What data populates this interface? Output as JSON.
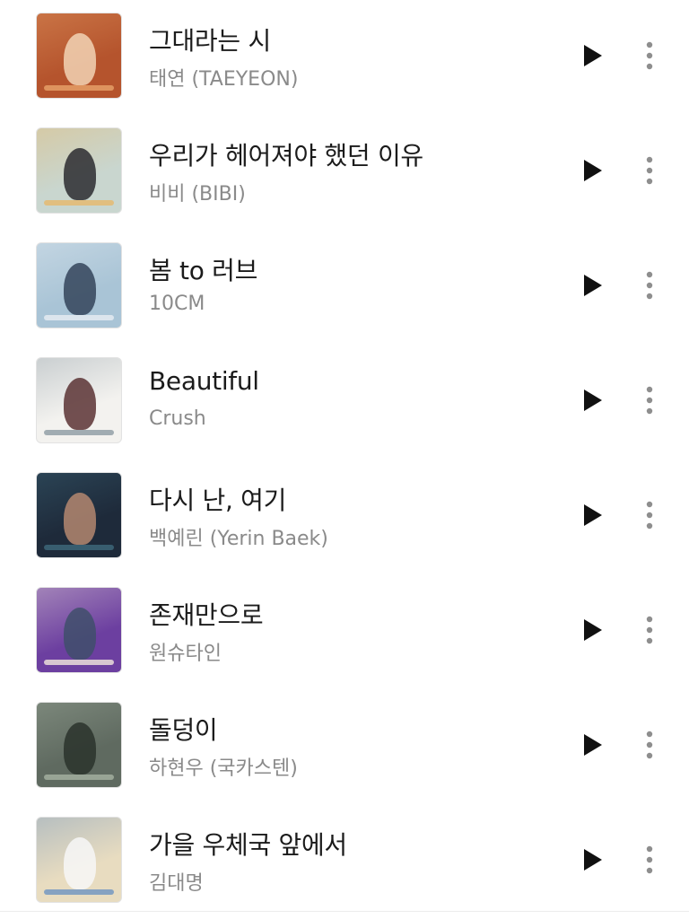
{
  "songs": [
    {
      "title": "그대라는 시",
      "artist": "태연 (TAEYEON)",
      "cover": {
        "bg": "#b5542d",
        "accent": "#e8a36a",
        "figure": "#f2d3b5",
        "icon": "album-cover-icon"
      }
    },
    {
      "title": "우리가 헤어져야 했던 이유",
      "artist": "비비 (BIBI)",
      "cover": {
        "bg": "#c9d6cf",
        "accent": "#e7b86a",
        "figure": "#2b2b30",
        "icon": "album-cover-icon"
      }
    },
    {
      "title": "봄 to 러브",
      "artist": "10CM",
      "cover": {
        "bg": "#a9c4d6",
        "accent": "#e9eef3",
        "figure": "#34445a",
        "icon": "album-cover-icon"
      }
    },
    {
      "title": "Beautiful",
      "artist": "Crush",
      "cover": {
        "bg": "#f3f2ef",
        "accent": "#8c9aa3",
        "figure": "#5a3234",
        "icon": "album-cover-icon"
      }
    },
    {
      "title": "다시 난, 여기",
      "artist": "백예린 (Yerin Baek)",
      "cover": {
        "bg": "#1e2a3a",
        "accent": "#3e6a7d",
        "figure": "#b48770",
        "icon": "album-cover-icon"
      }
    },
    {
      "title": "존재만으로",
      "artist": "원슈타인",
      "cover": {
        "bg": "#6c3fa0",
        "accent": "#f3e9dd",
        "figure": "#3f4f6b",
        "icon": "album-cover-icon"
      }
    },
    {
      "title": "돌덩이",
      "artist": "하현우 (국카스텐)",
      "cover": {
        "bg": "#5f6a60",
        "accent": "#a6b3a3",
        "figure": "#2a332c",
        "icon": "album-cover-icon"
      }
    },
    {
      "title": "가을 우체국 앞에서",
      "artist": "김대명",
      "cover": {
        "bg": "#e8dcc0",
        "accent": "#6d93c0",
        "figure": "#f7f7f7",
        "icon": "album-cover-icon"
      }
    }
  ],
  "controls": {
    "play_icon": "play-icon",
    "more_icon": "more-vertical-icon",
    "icon_color": "#111111",
    "more_color": "#8e8e8e"
  }
}
